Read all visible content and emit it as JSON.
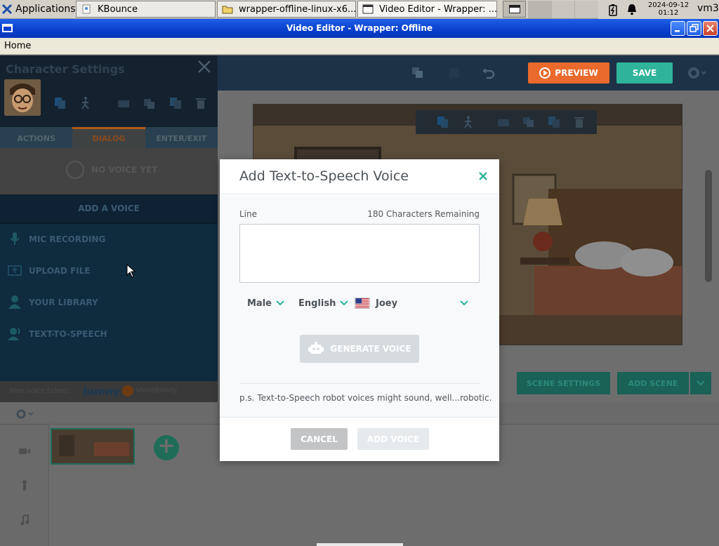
{
  "taskbar": {
    "applications_label": "Applications",
    "tasks": [
      {
        "label": "KBounce",
        "icon": "kbounce-icon"
      },
      {
        "label": "wrapper-offline-linux-x6...",
        "icon": "folder-icon"
      },
      {
        "label": "Video Editor - Wrapper: ...",
        "icon": "window-icon"
      }
    ],
    "clock_date": "2024-09-12",
    "clock_time": "01:12",
    "user": "vm3"
  },
  "window": {
    "title": "Video Editor - Wrapper: Offline"
  },
  "menubar": {
    "home": "Home"
  },
  "toolbar": {
    "preview_label": "PREVIEW",
    "save_label": "SAVE"
  },
  "character_panel": {
    "title": "Character Settings",
    "tabs": [
      "ACTIONS",
      "DIALOG",
      "ENTER/EXIT"
    ],
    "active_tab": "DIALOG",
    "no_voice_text": "NO VOICE YET",
    "add_voice_label": "ADD A VOICE",
    "voice_options": [
      {
        "label": "MIC RECORDING",
        "icon": "microphone-icon"
      },
      {
        "label": "UPLOAD FILE",
        "icon": "upload-icon"
      },
      {
        "label": "YOUR LIBRARY",
        "icon": "user-library-icon"
      },
      {
        "label": "TEXT-TO-SPEECH",
        "icon": "speech-icon"
      }
    ],
    "hire_text": "Hire voice talent:",
    "hire_brand_1": "bunny",
    "hire_brand_2": "VoiceBunny"
  },
  "stage": {
    "scene_settings_label": "SCENE SETTINGS",
    "add_scene_label": "ADD SCENE"
  },
  "modal": {
    "title": "Add Text-to-Speech Voice",
    "line_label": "Line",
    "chars_remaining": "180 Characters Remaining",
    "line_value": "",
    "gender": "Male",
    "language": "English",
    "voice": "Joey",
    "generate_label": "GENERATE VOICE",
    "note": "p.s. Text-to-Speech robot voices might sound, well...robotic.",
    "cancel_label": "CANCEL",
    "add_voice_label": "ADD VOICE"
  },
  "colors": {
    "accent_teal": "#2fb39a",
    "preview_orange": "#e96a2c",
    "titlebar_blue": "#0a3fcc"
  }
}
